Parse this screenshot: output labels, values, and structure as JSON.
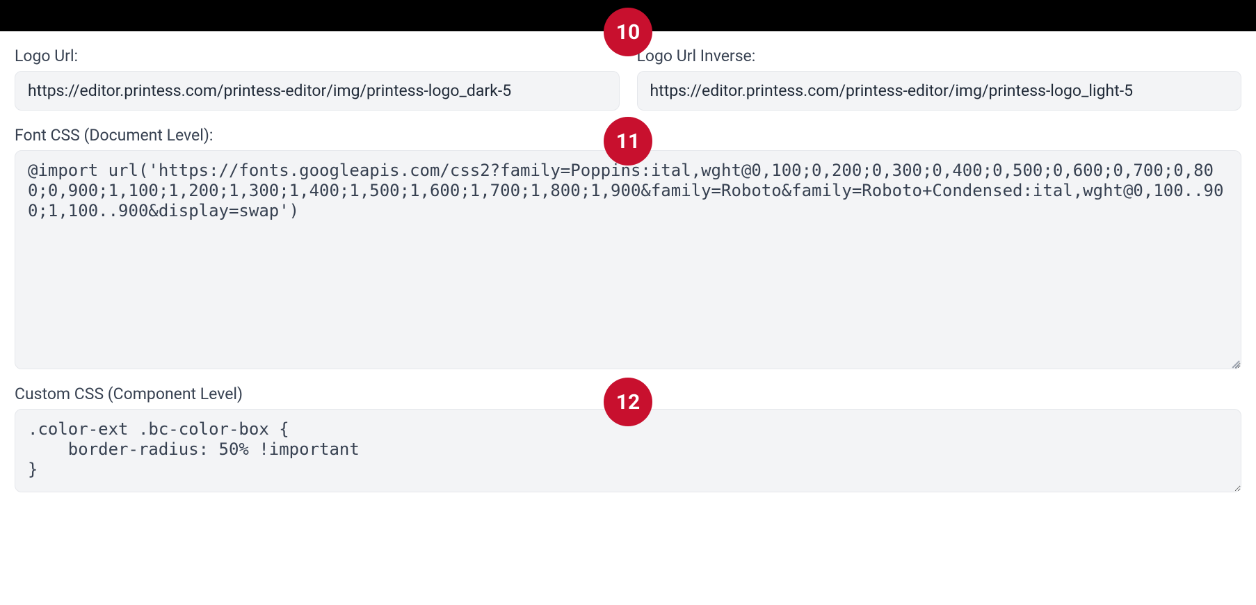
{
  "badges": {
    "ten": "10",
    "eleven": "11",
    "twelve": "12"
  },
  "logoUrl": {
    "label": "Logo Url:",
    "value": "https://editor.printess.com/printess-editor/img/printess-logo_dark-5"
  },
  "logoUrlInverse": {
    "label": "Logo Url Inverse:",
    "value": "https://editor.printess.com/printess-editor/img/printess-logo_light-5"
  },
  "fontCss": {
    "label": "Font CSS (Document Level):",
    "value": "@import url('https://fonts.googleapis.com/css2?family=Poppins:ital,wght@0,100;0,200;0,300;0,400;0,500;0,600;0,700;0,800;0,900;1,100;1,200;1,300;1,400;1,500;1,600;1,700;1,800;1,900&family=Roboto&family=Roboto+Condensed:ital,wght@0,100..900;1,100..900&display=swap')"
  },
  "customCss": {
    "label": "Custom CSS (Component Level)",
    "value": ".color-ext .bc-color-box {\n    border-radius: 50% !important\n}"
  }
}
